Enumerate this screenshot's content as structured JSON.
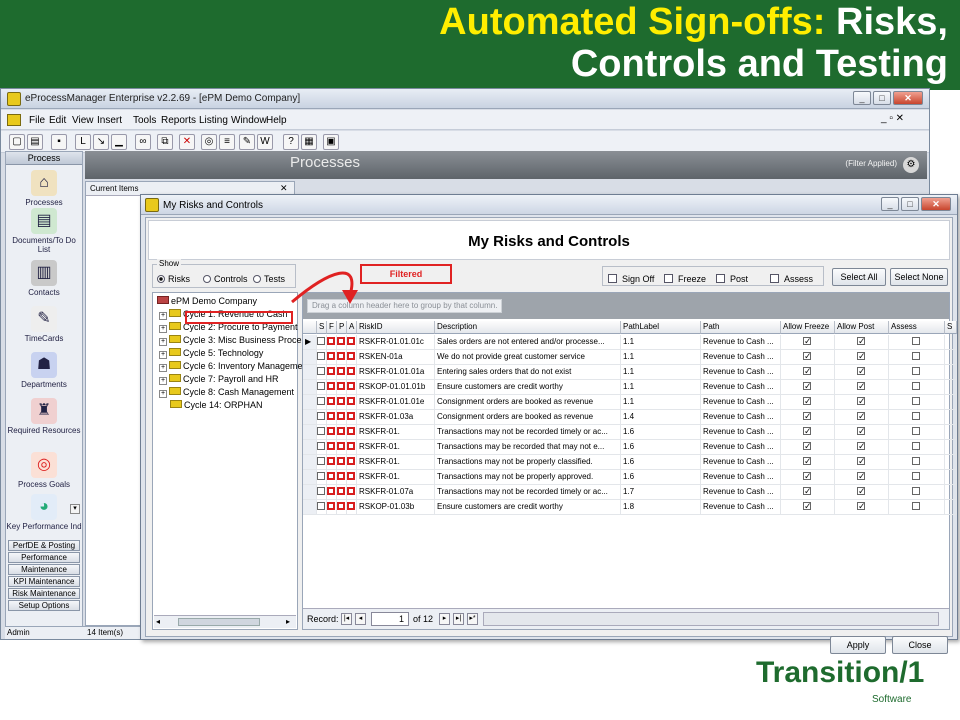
{
  "slide": {
    "title_highlight": "Automated Sign-offs:",
    "title_rest": "Risks,",
    "title_line2": "Controls and Testing",
    "brand": "Transition/1",
    "brand_sub": "Software"
  },
  "app": {
    "title": "eProcessManager Enterprise v2.2.69 - [ePM Demo Company]",
    "menus": [
      "File",
      "Edit",
      "View",
      "Insert",
      "Tools",
      "Reports",
      "Listing",
      "Window",
      "Help"
    ],
    "section_title": "Processes",
    "filter_applied": "(Filter Applied)",
    "current_items": "Current Items",
    "status_user": "Admin",
    "status_count": "14 Item(s)",
    "nav_header": "Process",
    "nav_items": [
      {
        "label": "Processes",
        "icon": "house-icon"
      },
      {
        "label": "Documents/To Do List",
        "icon": "documents-icon"
      },
      {
        "label": "Contacts",
        "icon": "contacts-icon"
      },
      {
        "label": "TimeCards",
        "icon": "timecard-icon"
      },
      {
        "label": "Departments",
        "icon": "departments-icon"
      },
      {
        "label": "Required Resources",
        "icon": "resources-icon"
      },
      {
        "label": "Process Goals",
        "icon": "target-icon"
      },
      {
        "label": "Key Performance Ind",
        "icon": "pie-chart-icon"
      }
    ],
    "nav_buttons": [
      "PerfDE & Posting",
      "Performance",
      "Maintenance",
      "KPI Maintenance",
      "Risk Maintenance",
      "Setup Options"
    ]
  },
  "dialog": {
    "title": "My Risks and Controls",
    "heading": "My Risks and Controls",
    "show_label": "Show",
    "show_options": [
      "Risks",
      "Controls",
      "Tests"
    ],
    "filtered_label": "Filtered",
    "checks": [
      "Sign Off",
      "Freeze",
      "Post",
      "Assess"
    ],
    "select_all": "Select All",
    "select_none": "Select None",
    "group_hint": "Drag a column header here to group by that column.",
    "tree_root": "ePM Demo Company",
    "tree_items": [
      "Cycle 1: Revenue to Cash",
      "Cycle 2: Procure to Payment",
      "Cycle 3: Misc Business Proce",
      "Cycle 5: Technology",
      "Cycle 6: Inventory Manageme",
      "Cycle 7: Payroll and HR",
      "Cycle 8: Cash Management",
      "Cycle 14: ORPHAN"
    ],
    "columns": [
      "S",
      "F",
      "P",
      "A",
      "RiskID",
      "Description",
      "PathLabel",
      "Path",
      "Allow Freeze",
      "Allow Post",
      "Assess",
      "S"
    ],
    "rows": [
      {
        "id": "RSKFR-01.01.01c",
        "desc": "Sales orders are not entered and/or processe...",
        "pl": "1.1",
        "path": "Revenue to Cash ..."
      },
      {
        "id": "RSKEN-01a",
        "desc": "We do not provide great customer service",
        "pl": "1.1",
        "path": "Revenue to Cash ..."
      },
      {
        "id": "RSKFR-01.01.01a",
        "desc": "Entering sales orders that do not exist",
        "pl": "1.1",
        "path": "Revenue to Cash ..."
      },
      {
        "id": "RSKOP-01.01.01b",
        "desc": "Ensure customers are credit worthy",
        "pl": "1.1",
        "path": "Revenue to Cash ..."
      },
      {
        "id": "RSKFR-01.01.01e",
        "desc": "Consignment orders are booked as revenue",
        "pl": "1.1",
        "path": "Revenue to Cash ..."
      },
      {
        "id": "RSKFR-01.03a",
        "desc": "Consignment orders are booked as revenue",
        "pl": "1.4",
        "path": "Revenue to Cash ..."
      },
      {
        "id": "RSKFR-01.",
        "desc": "Transactions may not be recorded timely or ac...",
        "pl": "1.6",
        "path": "Revenue to Cash ..."
      },
      {
        "id": "RSKFR-01.",
        "desc": "Transactions may be recorded that may not e...",
        "pl": "1.6",
        "path": "Revenue to Cash ..."
      },
      {
        "id": "RSKFR-01.",
        "desc": "Transactions may not be properly classified.",
        "pl": "1.6",
        "path": "Revenue to Cash ..."
      },
      {
        "id": "RSKFR-01.",
        "desc": "Transactions may not be properly approved.",
        "pl": "1.6",
        "path": "Revenue to Cash ..."
      },
      {
        "id": "RSKFR-01.07a",
        "desc": "Transactions may not be recorded timely or ac...",
        "pl": "1.7",
        "path": "Revenue to Cash ..."
      },
      {
        "id": "RSKOP-01.03b",
        "desc": "Ensure customers are credit worthy",
        "pl": "1.8",
        "path": "Revenue to Cash ..."
      }
    ],
    "record_label": "Record:",
    "record_num": "1",
    "record_of": "of 12",
    "apply": "Apply",
    "close": "Close"
  }
}
